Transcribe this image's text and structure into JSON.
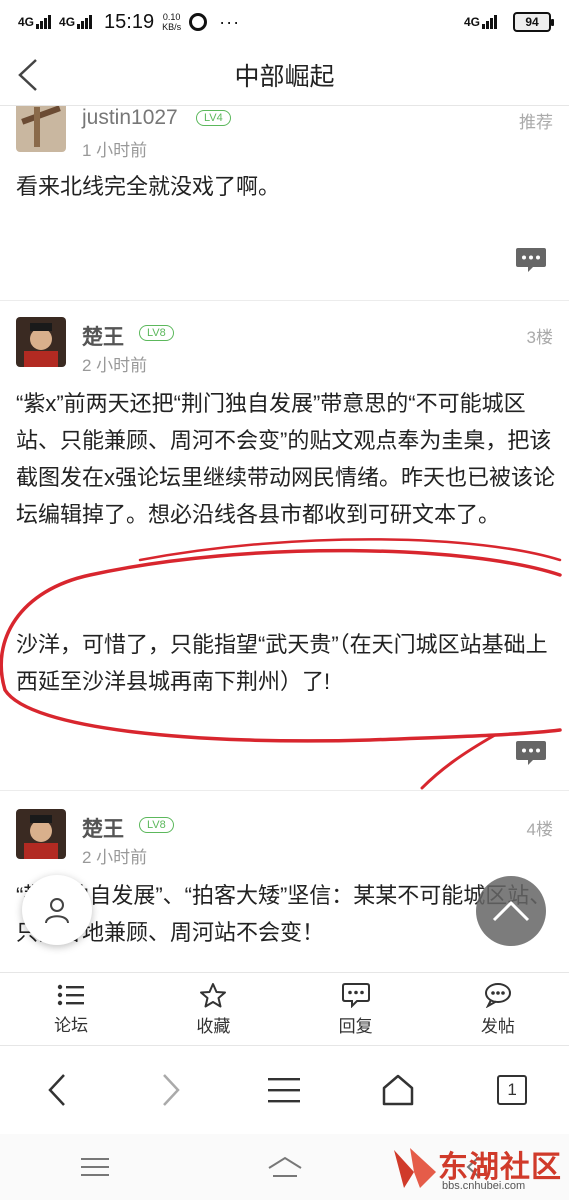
{
  "status_bar": {
    "net1": "4G",
    "net2": "4G",
    "time": "15:19",
    "speed_value": "0.10",
    "speed_unit": "KB/s",
    "dots": "···",
    "net3": "4G",
    "battery": "94"
  },
  "header": {
    "title": "中部崛起"
  },
  "posts": [
    {
      "username": "justin1027",
      "level": "LV4",
      "time": "1 小时前",
      "floor": "推荐",
      "text": "看来北线完全就没戏了啊。"
    },
    {
      "username": "楚王",
      "level": "LV8",
      "time": "2 小时前",
      "floor": "3楼",
      "paragraphs": [
        "“紫x”前两天还把“荆门独自发展”带意思的“不可能城区站、只能兼顾、周河不会变”的贴文观点奉为圭臬，把该截图发在x强论坛里继续带动网民情绪。昨天也已被该论坛编辑掉了。想必沿线各县市都收到可研文本了。",
        "沙洋，可惜了，只能指望“武天贵”（在天门城区站基础上西延至沙洋县城再南下荆州）了!"
      ]
    },
    {
      "username": "楚王",
      "level": "LV8",
      "time": "2 小时前",
      "floor": "4楼",
      "text": "“荆门独自发展”、“拍客大矮”坚信：某某不可能城区站、只能各地兼顾、周河站不会变！"
    }
  ],
  "toolbar": [
    {
      "label": "论坛",
      "icon": "list-icon"
    },
    {
      "label": "收藏",
      "icon": "star-icon"
    },
    {
      "label": "回复",
      "icon": "reply-icon"
    },
    {
      "label": "发帖",
      "icon": "post-icon"
    }
  ],
  "browser": {
    "tab_count": "1"
  },
  "watermark": {
    "brand": "东湖社区",
    "url": "bbs.cnhubei.com"
  }
}
